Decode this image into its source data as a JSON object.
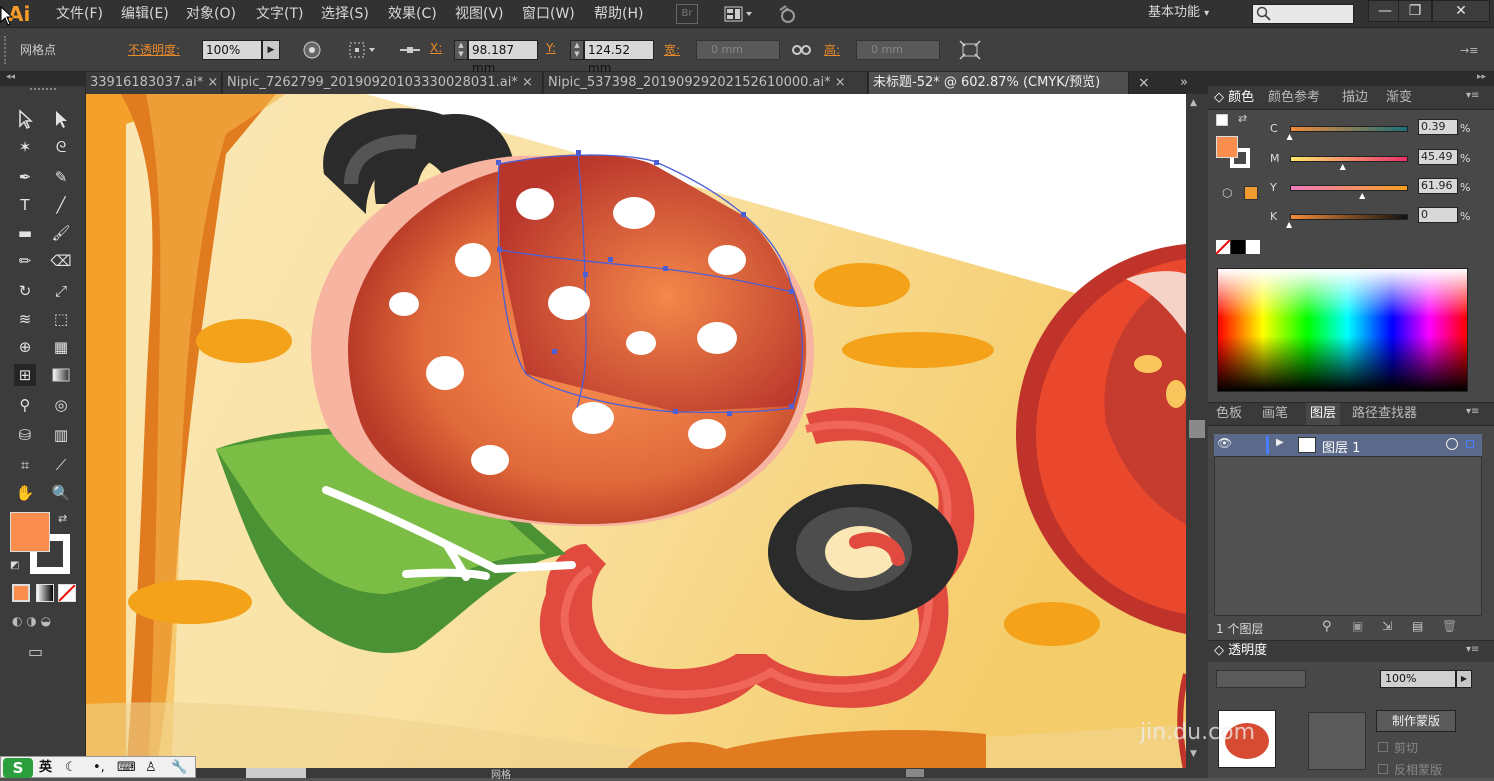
{
  "app": {
    "logo": "Ai"
  },
  "menu": [
    "文件(F)",
    "编辑(E)",
    "对象(O)",
    "文字(T)",
    "选择(S)",
    "效果(C)",
    "视图(V)",
    "窗口(W)",
    "帮助(H)"
  ],
  "toolbar": {
    "bridge_label": "Br",
    "workspace": "基本功能",
    "window_minimize": "—",
    "window_restore": "❐",
    "window_close": "✕"
  },
  "control": {
    "selection_type": "网格点",
    "opacity_label": "不透明度:",
    "opacity_value": "100%",
    "x_label": "X:",
    "x_value": "98.187 mm",
    "y_label": "Y:",
    "y_value": "124.52 mm",
    "w_label": "宽:",
    "w_value": "0 mm",
    "h_label": "高:",
    "h_value": "0 mm"
  },
  "tabs": [
    {
      "label": "33916183037.ai* ×",
      "active": false
    },
    {
      "label": "Nipic_7262799_20190920103330028031.ai* ×",
      "active": false
    },
    {
      "label": "Nipic_537398_20190929202152610000.ai* ×",
      "active": false
    },
    {
      "label": "未标题-52* @ 602.87% (CMYK/预览)",
      "active": true
    }
  ],
  "tab_close": "×",
  "color_panel": {
    "tabs": [
      "颜色",
      "颜色参考",
      "描边",
      "渐变"
    ],
    "channels": [
      {
        "label": "C",
        "value": "0.39",
        "unit": "%",
        "pos": 0.0039,
        "grad": "linear-gradient(to right,#f28c3a,#1b6e7a)"
      },
      {
        "label": "M",
        "value": "45.49",
        "unit": "%",
        "pos": 0.4549,
        "grad": "linear-gradient(to right,#ffe86a,#e8306a)"
      },
      {
        "label": "Y",
        "value": "61.96",
        "unit": "%",
        "pos": 0.6196,
        "grad": "linear-gradient(to right,#f07ac0,#f5a020)"
      },
      {
        "label": "K",
        "value": "0",
        "unit": "%",
        "pos": 0.0,
        "grad": "linear-gradient(to right,#f28c3a,#111)"
      }
    ],
    "fill_color": "#fb8d4f"
  },
  "layers_panel": {
    "tabs": [
      "色板",
      "画笔",
      "图层",
      "路径查找器"
    ],
    "layers": [
      {
        "name": "图层 1"
      }
    ],
    "count_label": "1 个图层"
  },
  "transparency_panel": {
    "title": "透明度",
    "opacity_value": "100%",
    "make_mask": "制作蒙版",
    "clip_label": "剪切",
    "invert_label": "反相蒙版"
  },
  "status": {
    "label": "网格"
  },
  "ime": {
    "lang": "英",
    "icons": [
      "moon-icon",
      "punct-icon",
      "keyboard-icon",
      "skin-icon",
      "wrench-icon"
    ]
  },
  "watermark": "jin.du.com"
}
